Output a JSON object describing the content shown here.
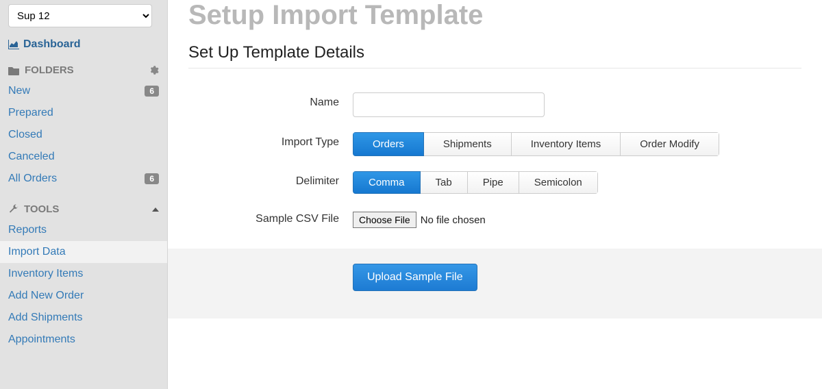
{
  "sidebar": {
    "select_value": "Sup 12",
    "dashboard_label": "Dashboard",
    "folders_section_label": "FOLDERS",
    "folders": [
      {
        "label": "New",
        "badge": "6"
      },
      {
        "label": "Prepared",
        "badge": ""
      },
      {
        "label": "Closed",
        "badge": ""
      },
      {
        "label": "Canceled",
        "badge": ""
      },
      {
        "label": "All Orders",
        "badge": "6"
      }
    ],
    "tools_section_label": "TOOLS",
    "tools": [
      {
        "label": "Reports"
      },
      {
        "label": "Import Data"
      },
      {
        "label": "Inventory Items"
      },
      {
        "label": "Add New Order"
      },
      {
        "label": "Add Shipments"
      },
      {
        "label": "Appointments"
      }
    ]
  },
  "main": {
    "page_title": "Setup Import Template",
    "section_title": "Set Up Template Details",
    "labels": {
      "name": "Name",
      "import_type": "Import Type",
      "delimiter": "Delimiter",
      "sample_csv": "Sample CSV File"
    },
    "import_type_options": [
      "Orders",
      "Shipments",
      "Inventory Items",
      "Order Modify"
    ],
    "import_type_selected": "Orders",
    "delimiter_options": [
      "Comma",
      "Tab",
      "Pipe",
      "Semicolon"
    ],
    "delimiter_selected": "Comma",
    "choose_file_label": "Choose File",
    "no_file_chosen": "No file chosen",
    "upload_button": "Upload Sample File",
    "name_value": ""
  }
}
